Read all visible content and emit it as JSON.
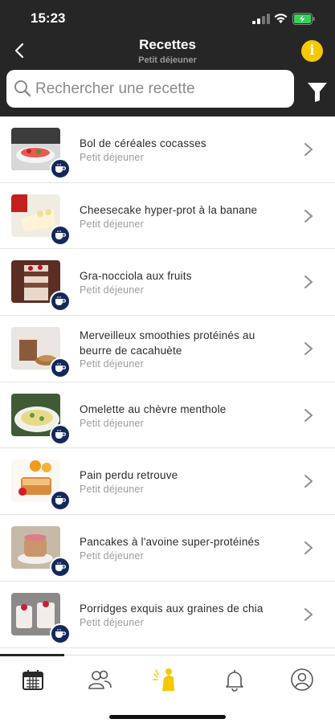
{
  "status_bar": {
    "time": "15:23"
  },
  "header": {
    "title": "Recettes",
    "subtitle": "Petit déjeuner",
    "info_label": "i"
  },
  "search": {
    "placeholder": "Rechercher une recette",
    "value": ""
  },
  "recipes": [
    {
      "name": "Bol de céréales cocasses",
      "category": "Petit déjeuner"
    },
    {
      "name": "Cheesecake hyper-prot à la banane",
      "category": "Petit déjeuner"
    },
    {
      "name": "Gra-nocciola aux fruits",
      "category": "Petit déjeuner"
    },
    {
      "name": "Merveilleux smoothies protéinés au beurre de cacahuète",
      "category": "Petit déjeuner"
    },
    {
      "name": "Omelette au chèvre menthole",
      "category": "Petit déjeuner"
    },
    {
      "name": "Pain perdu retrouve",
      "category": "Petit déjeuner"
    },
    {
      "name": "Pancakes à l'avoine super-protéinés",
      "category": "Petit déjeuner"
    },
    {
      "name": "Porridges exquis aux graines de chia",
      "category": "Petit déjeuner"
    }
  ],
  "tabs": [
    {
      "icon": "calendar-icon"
    },
    {
      "icon": "community-icon"
    },
    {
      "icon": "coach-icon"
    },
    {
      "icon": "bell-icon"
    },
    {
      "icon": "profile-icon"
    }
  ],
  "colors": {
    "header_bg": "#262626",
    "accent_yellow": "#f6c800",
    "badge_navy": "#14285c"
  }
}
